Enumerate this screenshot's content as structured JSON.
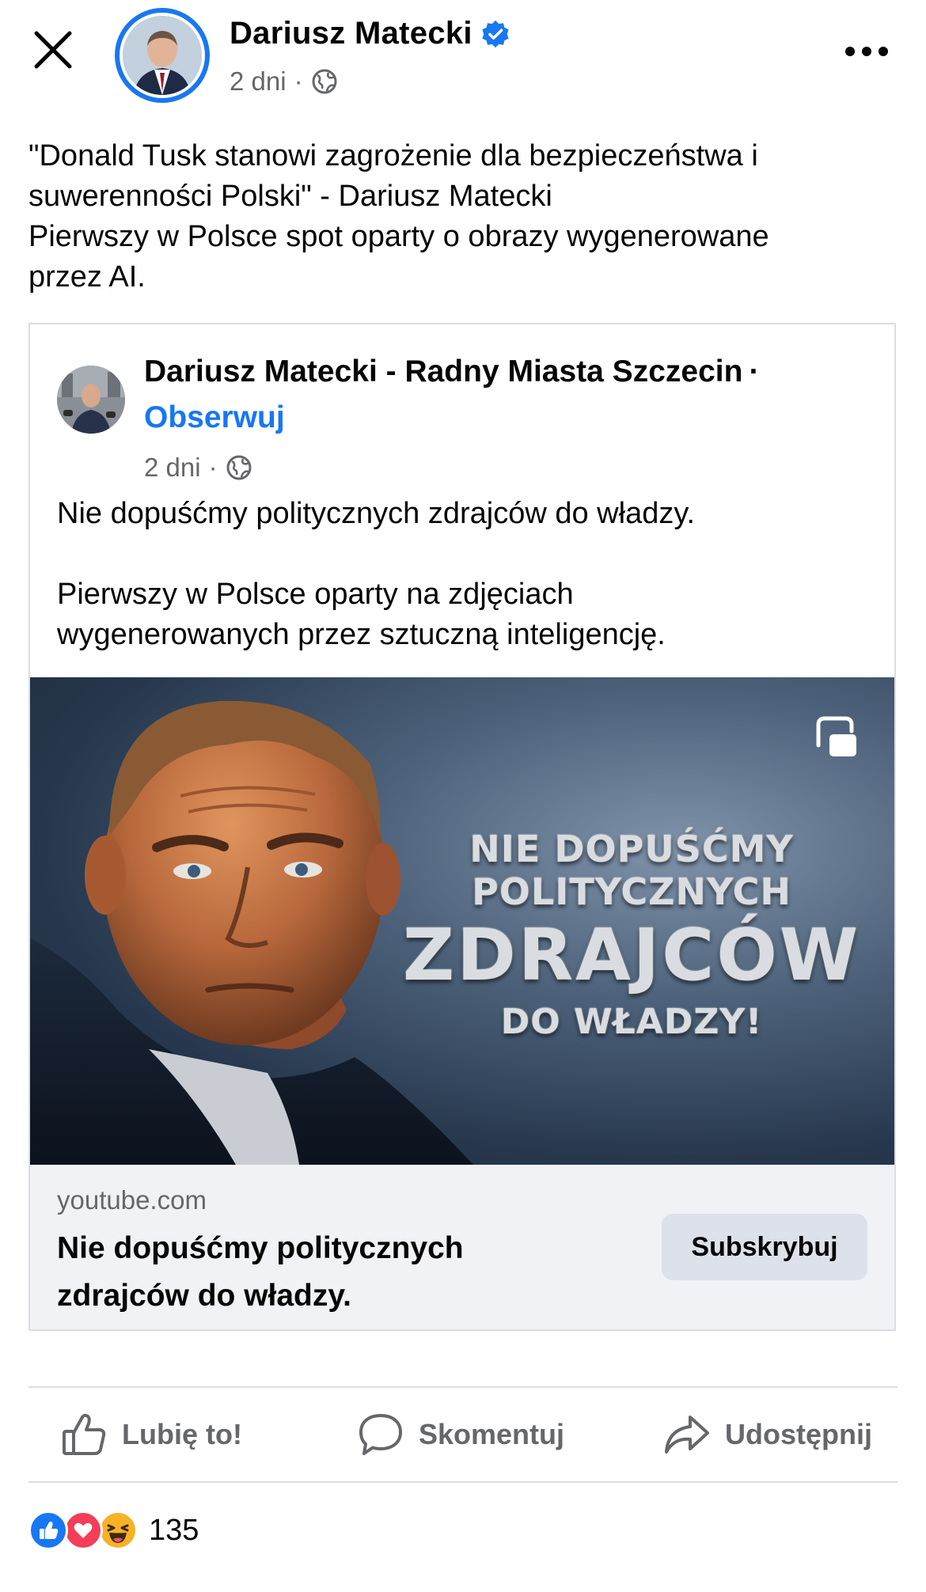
{
  "header": {
    "author_name": "Dariusz Matecki",
    "time": "2 dni",
    "separator": "·",
    "audience_icon": "globe-icon",
    "close_icon": "close-icon",
    "more_icon": "more-icon"
  },
  "caption": {
    "lines": [
      "\"Donald Tusk stanowi zagrożenie dla bezpieczeństwa i",
      "suwerenności Polski\" - Dariusz Matecki",
      "Pierwszy w Polsce spot oparty o obrazy wygenerowane",
      "przez AI."
    ]
  },
  "shared_post": {
    "page_name": "Dariusz Matecki - Radny Miasta Szczecin",
    "separator": "·",
    "follow_label": "Obserwuj",
    "time": "2 dni",
    "audience_icon": "globe-icon",
    "text_line_1": "Nie dopuśćmy politycznych zdrajców do władzy.",
    "text_line_2": "Pierwszy w Polsce oparty na zdjęciach",
    "text_line_3": "wygenerowanych przez sztuczną inteligencję."
  },
  "video": {
    "overlay_line_1": "NIE DOPUŚĆMY",
    "overlay_line_2": "POLITYCZNYCH",
    "overlay_line_3": "ZDRAJCÓW",
    "overlay_line_4": "DO WŁADZY!",
    "pip_icon": "picture-in-picture-icon"
  },
  "link_preview": {
    "domain": "youtube.com",
    "title": "Nie dopuśćmy politycznych zdrajców do władzy.",
    "subscribe_label": "Subskrybuj"
  },
  "actions": {
    "like_label": "Lubię to!",
    "comment_label": "Skomentuj",
    "share_label": "Udostępnij"
  },
  "reactions": {
    "count": "135",
    "types": [
      "like",
      "love",
      "haha"
    ]
  },
  "colors": {
    "accent_blue": "#1877f2",
    "secondary_text": "#65676b",
    "divider": "#dadde1",
    "footer_bg": "#f0f2f5",
    "love_red": "#f33e58",
    "haha_yellow": "#f7b125"
  }
}
